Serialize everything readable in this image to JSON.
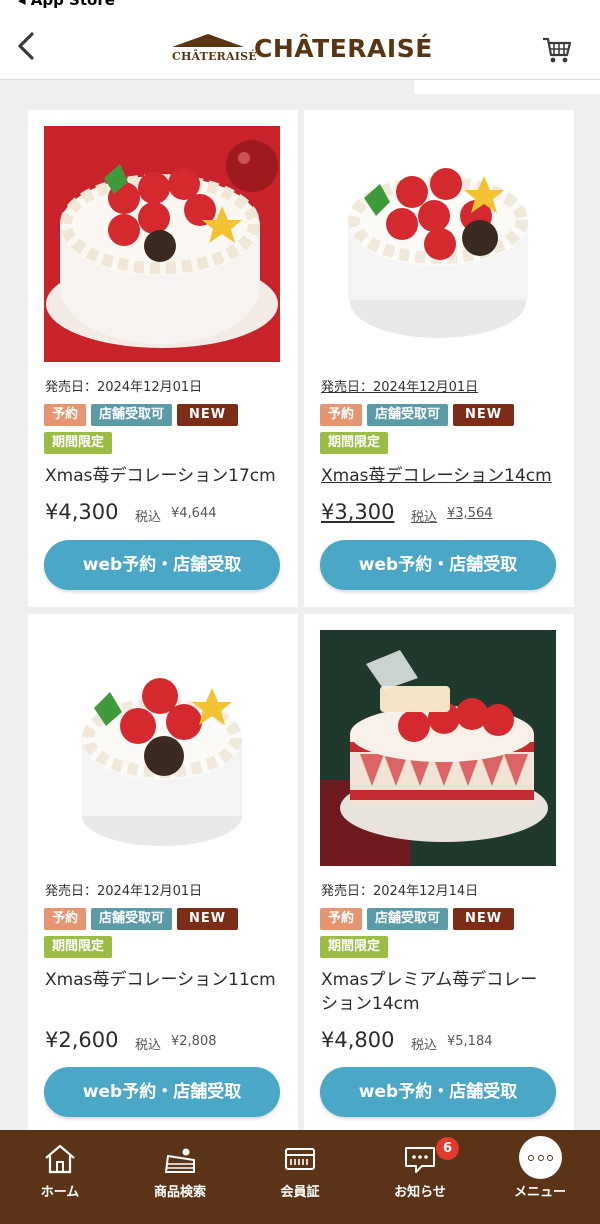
{
  "status_bar": {
    "back_app_label": "◂ App Store"
  },
  "header": {
    "logo_small": "CHÂTERAISÉ",
    "logo_large": "CHÂTERAISÉ"
  },
  "products": [
    {
      "release_date": "発売日：2024年12月01日",
      "tags": {
        "reserve": "予約",
        "store": "店舗受取可",
        "new": "NEW",
        "limited": "期間限定"
      },
      "name": "Xmas苺デコレーション17cm",
      "price": "¥4,300",
      "tax_label": "税込",
      "tax_price": "¥4,644",
      "button_label": "web予約・店舗受取"
    },
    {
      "release_date": "発売日：2024年12月01日",
      "tags": {
        "reserve": "予約",
        "store": "店舗受取可",
        "new": "NEW",
        "limited": "期間限定"
      },
      "name": "Xmas苺デコレーション14cm",
      "price": "¥3,300",
      "tax_label": "税込",
      "tax_price": "¥3,564",
      "button_label": "web予約・店舗受取"
    },
    {
      "release_date": "発売日：2024年12月01日",
      "tags": {
        "reserve": "予約",
        "store": "店舗受取可",
        "new": "NEW",
        "limited": "期間限定"
      },
      "name": "Xmas苺デコレーション11cm",
      "price": "¥2,600",
      "tax_label": "税込",
      "tax_price": "¥2,808",
      "button_label": "web予約・店舗受取"
    },
    {
      "release_date": "発売日：2024年12月14日",
      "tags": {
        "reserve": "予約",
        "store": "店舗受取可",
        "new": "NEW",
        "limited": "期間限定"
      },
      "name": "Xmasプレミアム苺デコレーション14cm",
      "price": "¥4,800",
      "tax_label": "税込",
      "tax_price": "¥5,184",
      "button_label": "web予約・店舗受取"
    }
  ],
  "bottom_nav": {
    "items": [
      {
        "label": "ホーム",
        "icon": "home-icon"
      },
      {
        "label": "商品検索",
        "icon": "cake-search-icon"
      },
      {
        "label": "会員証",
        "icon": "member-card-icon"
      },
      {
        "label": "お知らせ",
        "icon": "notification-icon"
      },
      {
        "label": "メニュー",
        "icon": "menu-icon"
      }
    ],
    "notification_count": "6"
  },
  "colors": {
    "brand_brown": "#5b3417",
    "button_blue": "#4aa7c6",
    "tag_reserve": "#e5956f",
    "tag_store": "#5b9aa7",
    "tag_new": "#7b2d17",
    "tag_limited": "#9cbc46"
  }
}
